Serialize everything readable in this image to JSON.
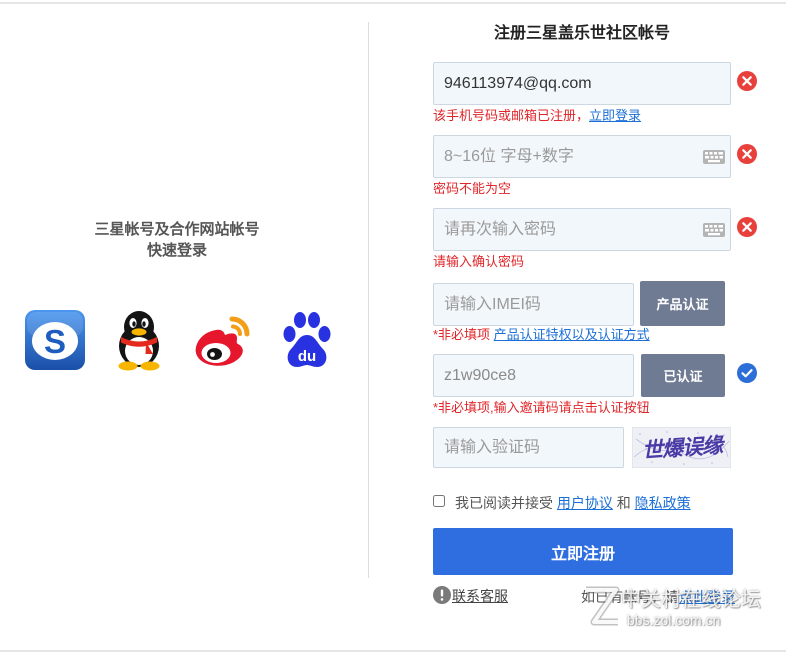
{
  "left": {
    "heading_line1": "三星帐号及合作网站帐号",
    "heading_line2": "快速登录",
    "social": {
      "samsung": {
        "icon": "samsung-s-icon",
        "letter": "S"
      },
      "qq": {
        "icon": "qq-penguin-icon"
      },
      "weibo": {
        "icon": "weibo-icon"
      },
      "baidu": {
        "icon": "baidu-paw-icon",
        "letter": "du"
      }
    }
  },
  "form": {
    "title": "注册三星盖乐世社区帐号",
    "account": {
      "value": "946113974@qq.com",
      "status_icon": "error-x-icon",
      "error_text": "该手机号码或邮箱已注册，",
      "error_link": "立即登录"
    },
    "password": {
      "placeholder": "8~16位 字母+数字",
      "keyboard_icon": "keyboard-icon",
      "status_icon": "error-x-icon",
      "error_text": "密码不能为空"
    },
    "confirm_password": {
      "placeholder": "请再次输入密码",
      "keyboard_icon": "keyboard-icon",
      "status_icon": "error-x-icon",
      "error_text": "请输入确认密码"
    },
    "imei": {
      "placeholder": "请输入IMEI码",
      "button_label": "产品认证",
      "note": "*非必填项 ",
      "note_link": "产品认证特权以及认证方式"
    },
    "invite": {
      "value": "z1w90ce8",
      "button_label": "已认证",
      "status_icon": "check-circle-icon",
      "note": "*非必填项,输入邀请码请点击认证按钮"
    },
    "captcha": {
      "placeholder": "请输入验证码",
      "image_text": "世爆误缘"
    },
    "agreement": {
      "checked": false,
      "text": "我已阅读并接受",
      "link1": "用户协议",
      "and": "和",
      "link2": "隐私政策"
    },
    "submit_label": "立即注册",
    "contact_label": "联系客服",
    "contact_icon": "info-circle-icon",
    "login_prompt": "如已有帐号，请",
    "login_link": "点此登录"
  },
  "watermark": {
    "line1": "中关村在线论坛",
    "line2": "bbs.zol.com.cn"
  },
  "colors": {
    "accent": "#2f6ee0",
    "error": "#e0262a",
    "link": "#1b6fd6",
    "auth_button": "#6f7b93",
    "verified": "#2d6fd8",
    "input_bg": "#f2f7fb"
  }
}
